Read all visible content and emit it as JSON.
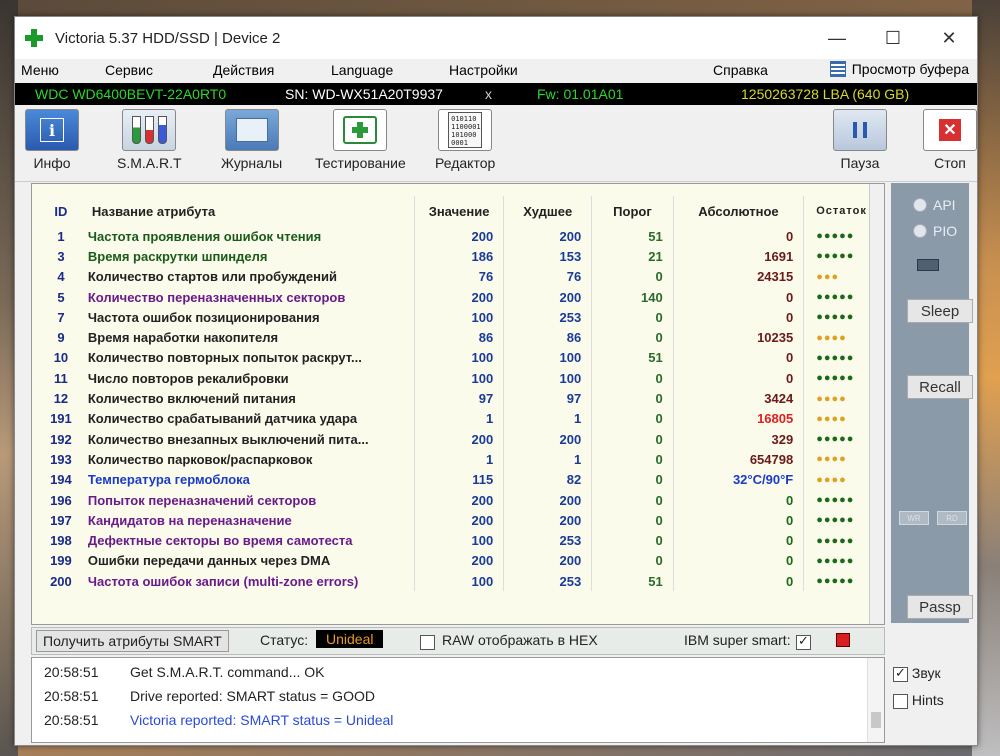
{
  "window": {
    "title": "Victoria 5.37 HDD/SSD | Device 2",
    "controls": {
      "minimize": "—",
      "maximize": "☐",
      "close": "✕"
    }
  },
  "menu": {
    "items": [
      "Меню",
      "Сервис",
      "Действия",
      "Language",
      "Настройки",
      "Справка"
    ],
    "buffer_view": "Просмотр буфера"
  },
  "drive": {
    "model": "WDC WD6400BEVT-22A0RT0",
    "serial": "SN: WD-WX51A20T9937",
    "eject": "x",
    "firmware": "Fw: 01.01A01",
    "capacity": "1250263728 LBA (640 GB)"
  },
  "toolbar": {
    "info": "Инфо",
    "smart": "S.M.A.R.T",
    "logs": "Журналы",
    "testing": "Тестирование",
    "editor": "Редактор",
    "pause": "Пауза",
    "stop": "Стоп",
    "info_glyph": "i",
    "editor_glyph": "010110 1100001 101000 0001",
    "stop_glyph": "✕"
  },
  "smart_table": {
    "headers": {
      "id": "ID",
      "name": "Название атрибута",
      "value": "Значение",
      "worst": "Худшее",
      "threshold": "Порог",
      "raw": "Абсолютное",
      "remaining": "Остаток"
    },
    "rows": [
      {
        "id": "1",
        "name": "Частота проявления ошибок чтения",
        "value": "200",
        "worst": "200",
        "threshold": "51",
        "raw": "0",
        "health": "●●●●●",
        "name_color": "green",
        "raw_color": "dark",
        "health_color": "green"
      },
      {
        "id": "3",
        "name": "Время раскрутки шпинделя",
        "value": "186",
        "worst": "153",
        "threshold": "21",
        "raw": "1691",
        "health": "●●●●●",
        "name_color": "green",
        "raw_color": "dark",
        "health_color": "green"
      },
      {
        "id": "4",
        "name": "Количество стартов или пробуждений",
        "value": "76",
        "worst": "76",
        "threshold": "0",
        "raw": "24315",
        "health": "●●●",
        "name_color": "dark",
        "raw_color": "dark",
        "health_color": "yellow"
      },
      {
        "id": "5",
        "name": "Количество переназначенных секторов",
        "value": "200",
        "worst": "200",
        "threshold": "140",
        "raw": "0",
        "health": "●●●●●",
        "name_color": "purple",
        "raw_color": "dark",
        "health_color": "green"
      },
      {
        "id": "7",
        "name": "Частота ошибок позиционирования",
        "value": "100",
        "worst": "253",
        "threshold": "0",
        "raw": "0",
        "health": "●●●●●",
        "name_color": "dark",
        "raw_color": "dark",
        "health_color": "green"
      },
      {
        "id": "9",
        "name": "Время наработки накопителя",
        "value": "86",
        "worst": "86",
        "threshold": "0",
        "raw": "10235",
        "health": "●●●●",
        "name_color": "dark",
        "raw_color": "dark",
        "health_color": "yellow"
      },
      {
        "id": "10",
        "name": "Количество повторных попыток раскрут...",
        "value": "100",
        "worst": "100",
        "threshold": "51",
        "raw": "0",
        "health": "●●●●●",
        "name_color": "dark",
        "raw_color": "dark",
        "health_color": "green"
      },
      {
        "id": "11",
        "name": "Число повторов рекалибровки",
        "value": "100",
        "worst": "100",
        "threshold": "0",
        "raw": "0",
        "health": "●●●●●",
        "name_color": "dark",
        "raw_color": "dark",
        "health_color": "green"
      },
      {
        "id": "12",
        "name": "Количество включений питания",
        "value": "97",
        "worst": "97",
        "threshold": "0",
        "raw": "3424",
        "health": "●●●●",
        "name_color": "dark",
        "raw_color": "dark",
        "health_color": "yellow"
      },
      {
        "id": "191",
        "name": "Количество срабатываний датчика удара",
        "value": "1",
        "worst": "1",
        "threshold": "0",
        "raw": "16805",
        "health": "●●●●",
        "name_color": "dark",
        "raw_color": "red",
        "health_color": "yellow"
      },
      {
        "id": "192",
        "name": "Количество внезапных выключений пита...",
        "value": "200",
        "worst": "200",
        "threshold": "0",
        "raw": "329",
        "health": "●●●●●",
        "name_color": "dark",
        "raw_color": "dark",
        "health_color": "green"
      },
      {
        "id": "193",
        "name": "Количество парковок/распарковок",
        "value": "1",
        "worst": "1",
        "threshold": "0",
        "raw": "654798",
        "health": "●●●●",
        "name_color": "dark",
        "raw_color": "dark",
        "health_color": "yellow"
      },
      {
        "id": "194",
        "name": "Температура гермоблока",
        "value": "115",
        "worst": "82",
        "threshold": "0",
        "raw": "32°C/90°F",
        "health": "●●●●",
        "name_color": "blue",
        "raw_color": "blue",
        "health_color": "yellow"
      },
      {
        "id": "196",
        "name": "Попыток переназначений секторов",
        "value": "200",
        "worst": "200",
        "threshold": "0",
        "raw": "0",
        "health": "●●●●●",
        "name_color": "purple",
        "raw_color": "green",
        "health_color": "green"
      },
      {
        "id": "197",
        "name": "Кандидатов на переназначение",
        "value": "200",
        "worst": "200",
        "threshold": "0",
        "raw": "0",
        "health": "●●●●●",
        "name_color": "purple",
        "raw_color": "green",
        "health_color": "green"
      },
      {
        "id": "198",
        "name": "Дефектные секторы во время самотеста",
        "value": "100",
        "worst": "253",
        "threshold": "0",
        "raw": "0",
        "health": "●●●●●",
        "name_color": "purple",
        "raw_color": "green",
        "health_color": "green"
      },
      {
        "id": "199",
        "name": "Ошибки передачи данных через DMA",
        "value": "200",
        "worst": "200",
        "threshold": "0",
        "raw": "0",
        "health": "●●●●●",
        "name_color": "dark",
        "raw_color": "green",
        "health_color": "green"
      },
      {
        "id": "200",
        "name": "Частота ошибок записи (multi-zone errors)",
        "value": "100",
        "worst": "253",
        "threshold": "51",
        "raw": "0",
        "health": "●●●●●",
        "name_color": "purple",
        "raw_color": "green",
        "health_color": "green"
      }
    ]
  },
  "right_panel": {
    "api": "API",
    "pio": "PIO",
    "sleep": "Sleep",
    "recall": "Recall",
    "wr": "WR",
    "rd": "RD",
    "passp": "Passp"
  },
  "status_bar": {
    "get_smart": "Получить атрибуты SMART",
    "status_label": "Статус:",
    "status_value": "Unideal",
    "raw_hex": "RAW отображать в HEX",
    "ibm_smart": "IBM super smart:"
  },
  "log": [
    {
      "time": "20:58:51",
      "message": "Get S.M.A.R.T. command... OK"
    },
    {
      "time": "20:58:51",
      "message": "Drive reported: SMART status = GOOD"
    },
    {
      "time": "20:58:51",
      "message": "Victoria reported: SMART status = Unideal"
    }
  ],
  "options": {
    "sound": "Звук",
    "hints": "Hints"
  },
  "colors": {
    "status_bg": "#000000",
    "status_fg": "#e89a20",
    "drive_model": "#2ad82a",
    "capacity": "#d8d82a",
    "accent_red": "#d83030"
  }
}
